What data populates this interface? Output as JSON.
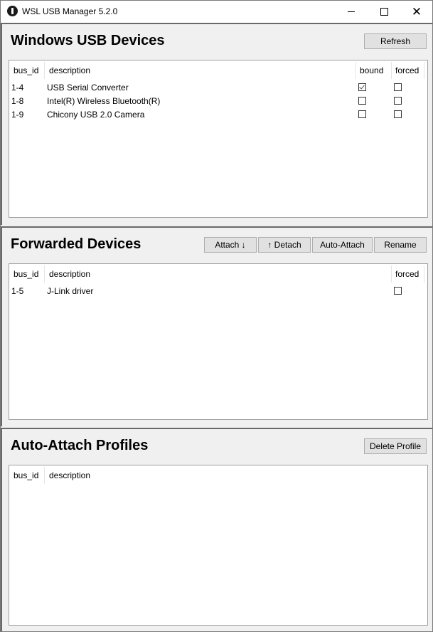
{
  "window": {
    "title": "WSL USB Manager 5.2.0",
    "controls": {
      "minimize": "minimize",
      "maximize": "maximize",
      "close": "close"
    }
  },
  "usb_devices": {
    "title": "Windows USB Devices",
    "refresh_label": "Refresh",
    "columns": [
      "bus_id",
      "description",
      "bound",
      "forced"
    ],
    "rows": [
      {
        "bus_id": "1-4",
        "description": "USB Serial Converter",
        "bound": true,
        "forced": false
      },
      {
        "bus_id": "1-8",
        "description": "Intel(R) Wireless Bluetooth(R)",
        "bound": false,
        "forced": false
      },
      {
        "bus_id": "1-9",
        "description": "Chicony USB 2.0 Camera",
        "bound": false,
        "forced": false
      }
    ]
  },
  "forwarded": {
    "title": "Forwarded Devices",
    "buttons": {
      "attach": "Attach ↓",
      "detach": "↑ Detach",
      "auto_attach": "Auto-Attach",
      "rename": "Rename"
    },
    "columns": [
      "bus_id",
      "description",
      "forced"
    ],
    "rows": [
      {
        "bus_id": "1-5",
        "description": "J-Link driver",
        "forced": false
      }
    ]
  },
  "profiles": {
    "title": "Auto-Attach Profiles",
    "delete_label": "Delete Profile",
    "columns": [
      "bus_id",
      "description"
    ],
    "rows": []
  }
}
